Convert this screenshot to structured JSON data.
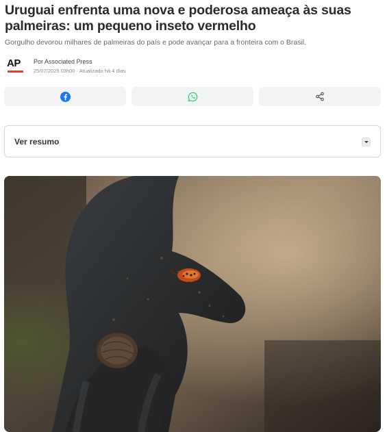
{
  "article": {
    "headline": "Uruguai enfrenta uma nova e poderosa ameaça às suas palmeiras: um pequeno inseto vermelho",
    "subtitle": "Gorgulho devorou milhares de palmeiras do país e pode avançar para a fronteira com o Brasil.",
    "author": "Por Associated Press",
    "meta": "25/07/2025 03h00 · Atualizado há 4 dias",
    "logo_text": "AP"
  },
  "share": {
    "buttons": [
      {
        "icon": "facebook-icon",
        "color": "#1877f2"
      },
      {
        "icon": "whatsapp-icon",
        "color": "#25d366"
      },
      {
        "icon": "share-icon",
        "color": "#555555"
      }
    ]
  },
  "summary": {
    "label": "Ver resumo"
  },
  "image": {
    "description_icon": "photo-glove-weevil"
  },
  "colors": {
    "ap_red": "#e63b2e",
    "button_bg": "#f2f3f5",
    "border": "#d6d6d6"
  }
}
